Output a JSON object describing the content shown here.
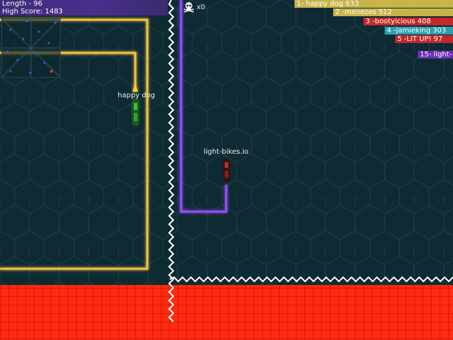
{
  "hud": {
    "length_text": "Length - 96",
    "high_score_text": "High Score: 1483",
    "kill_count_text": "x0"
  },
  "leaderboard": [
    {
      "text": "1- happy dog 633",
      "color": "#c9b44a"
    },
    {
      "text": "2 -menezes 512",
      "color": "#c9b44a"
    },
    {
      "text": "3 -bootyicious 408",
      "color": "#c4282b"
    },
    {
      "text": "4 -jamieking 303",
      "color": "#2a9fb0"
    },
    {
      "text": "5 -LIT UP! 97",
      "color": "#c4282b"
    },
    {
      "text": "15- light-",
      "color": "#6b2fb5"
    }
  ],
  "players": [
    {
      "name": "happy dog",
      "color": "#f4c542"
    },
    {
      "name": "light-bikes.io",
      "color": "#8a3cf0"
    }
  ],
  "colors": {
    "background": "#0e2a33",
    "hex_grid": "#1b3c46",
    "boundary_wall": "#ffffff",
    "danger_zone": "#ff2a10",
    "yellow_trail": "#f5c23c",
    "purple_trail": "#9a4bff"
  },
  "icons": {
    "kills": "skull-icon"
  }
}
